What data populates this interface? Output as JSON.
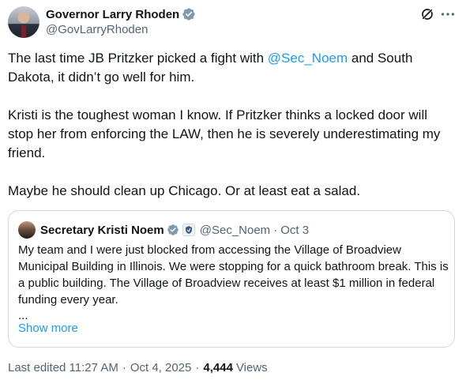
{
  "author": {
    "display_name": "Governor Larry Rhoden",
    "handle": "@GovLarryRhoden",
    "verified_icon": "verified-gray-badge",
    "badge_color": "#829aab"
  },
  "header_actions": {
    "grok_icon": "grok-icon",
    "more_icon": "more-horizontal-icon"
  },
  "tweet": {
    "para1_before": "The last time JB Pritzker picked a fight with ",
    "para1_mention": "@Sec_Noem",
    "para1_after": " and South Dakota, it didn’t go well for him.",
    "para2": "Kristi is the toughest woman I know. If Pritzker thinks a locked door will stop her from enforcing the LAW, then he is severely underestimating my friend.",
    "para3": "Maybe he should clean up Chicago. Or at least eat a salad."
  },
  "quote": {
    "display_name": "Secretary Kristi Noem",
    "handle": "@Sec_Noem",
    "separator": "·",
    "date": "Oct 3",
    "text": "My team and I were just blocked from accessing the Village of Broadview Municipal Building in Illinois. We were stopping for a quick bathroom break. This is a public building. The Village of Broadview receives at least $1 million in federal funding every year.",
    "ellipsis": "...",
    "show_more": "Show more"
  },
  "footer": {
    "edited": "Last edited 11:27 AM",
    "separator": "·",
    "date": "Oct 4, 2025",
    "separator2": "·",
    "views_count": "4,444",
    "views_label": "Views"
  },
  "colors": {
    "link": "#1d9bf0",
    "secondary_text": "#536471",
    "border": "#cfd9de",
    "verified_gray": "#829aab",
    "verified_blue": "#1d9bf0"
  }
}
